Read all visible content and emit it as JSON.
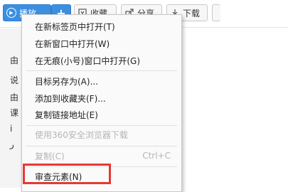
{
  "toolbar": {
    "play_label": "播放",
    "plus_label": "+",
    "favorite_label": "收藏",
    "share_label": "分享",
    "download_label": "下载"
  },
  "background_chars": [
    "由",
    "说",
    "由",
    "课",
    "i",
    "ر"
  ],
  "menu": {
    "items": [
      {
        "label": "在新标签页中打开(T)",
        "disabled": false
      },
      {
        "label": "在新窗口中打开(W)",
        "disabled": false
      },
      {
        "label": "在无痕(小号)窗口中打开(G)",
        "disabled": false
      },
      {
        "label": "目标另存为(A)...",
        "disabled": false
      },
      {
        "label": "添加到收藏夹(F)...",
        "disabled": false
      },
      {
        "label": "复制链接地址(E)",
        "disabled": false
      },
      {
        "label": "使用360安全浏览器下载",
        "disabled": true
      },
      {
        "label": "复制(C)",
        "disabled": true,
        "shortcut": "Ctrl+C"
      },
      {
        "label": "审查元素(N)",
        "disabled": false
      }
    ]
  },
  "colors": {
    "accent": "#3b8fe0",
    "highlight": "#e53935",
    "disabled": "#b5b5b5"
  }
}
